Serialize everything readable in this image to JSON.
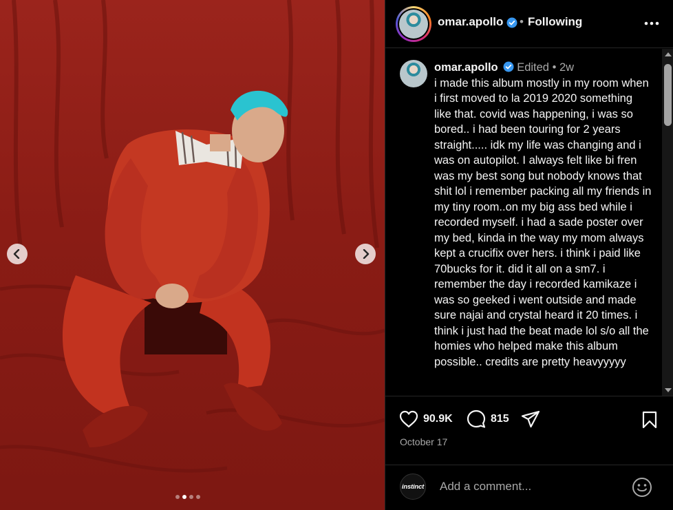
{
  "post": {
    "username": "omar.apollo",
    "follow_state": "Following",
    "separator": "•",
    "caption": {
      "username": "omar.apollo",
      "edited": "Edited",
      "dot": "•",
      "age": "2w",
      "text": "i made this album mostly in my room when i first moved to la 2019 2020 something like that.  covid was happening, i was so bored.. i had been touring for 2 years straight..... idk my life was changing and i was on autopilot. I always felt like bi fren was my best song but nobody knows that shit lol i remember packing all my friends in my tiny room..on my big ass bed while i recorded myself. i had a sade poster over my bed, kinda in the way my mom always kept a crucifix over hers. i think i paid like 70bucks for it. did it all on a sm7. i remember the day i recorded kamikaze i was so geeked i went outside and made sure najai and crystal heard it 20 times. i think i just had the beat made lol s/o all the homies who helped make this album possible.. credits are pretty heavyyyyy"
    },
    "likes": "90.9K",
    "comments": "815",
    "date": "October 17"
  },
  "carousel": {
    "total": 4,
    "active": 2
  },
  "comment_box": {
    "placeholder": "Add a comment...",
    "avatar_text": "instinct"
  },
  "icons": {
    "verified": "verified-badge-icon",
    "more": "more-options-icon",
    "like": "heart-icon",
    "comment": "comment-bubble-icon",
    "share": "paper-plane-icon",
    "save": "bookmark-icon",
    "emoji": "smiley-icon",
    "prev": "chevron-left-icon",
    "next": "chevron-right-icon"
  },
  "colors": {
    "verified": "#3797f0",
    "background": "#000000",
    "muted_text": "#a8a8a8"
  }
}
